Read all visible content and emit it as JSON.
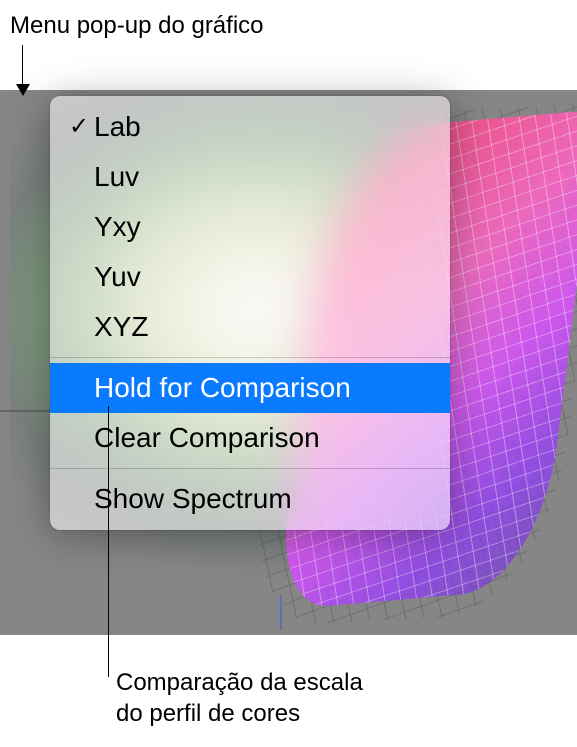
{
  "callouts": {
    "top": "Menu pop-up do gráfico",
    "bottom_line1": "Comparação da escala",
    "bottom_line2": "do perfil de cores"
  },
  "menu": {
    "items": [
      {
        "label": "Lab",
        "checked": true
      },
      {
        "label": "Luv",
        "checked": false
      },
      {
        "label": "Yxy",
        "checked": false
      },
      {
        "label": "Yuv",
        "checked": false
      },
      {
        "label": "XYZ",
        "checked": false
      }
    ],
    "hold_comparison": "Hold for Comparison",
    "clear_comparison": "Clear Comparison",
    "show_spectrum": "Show Spectrum"
  }
}
